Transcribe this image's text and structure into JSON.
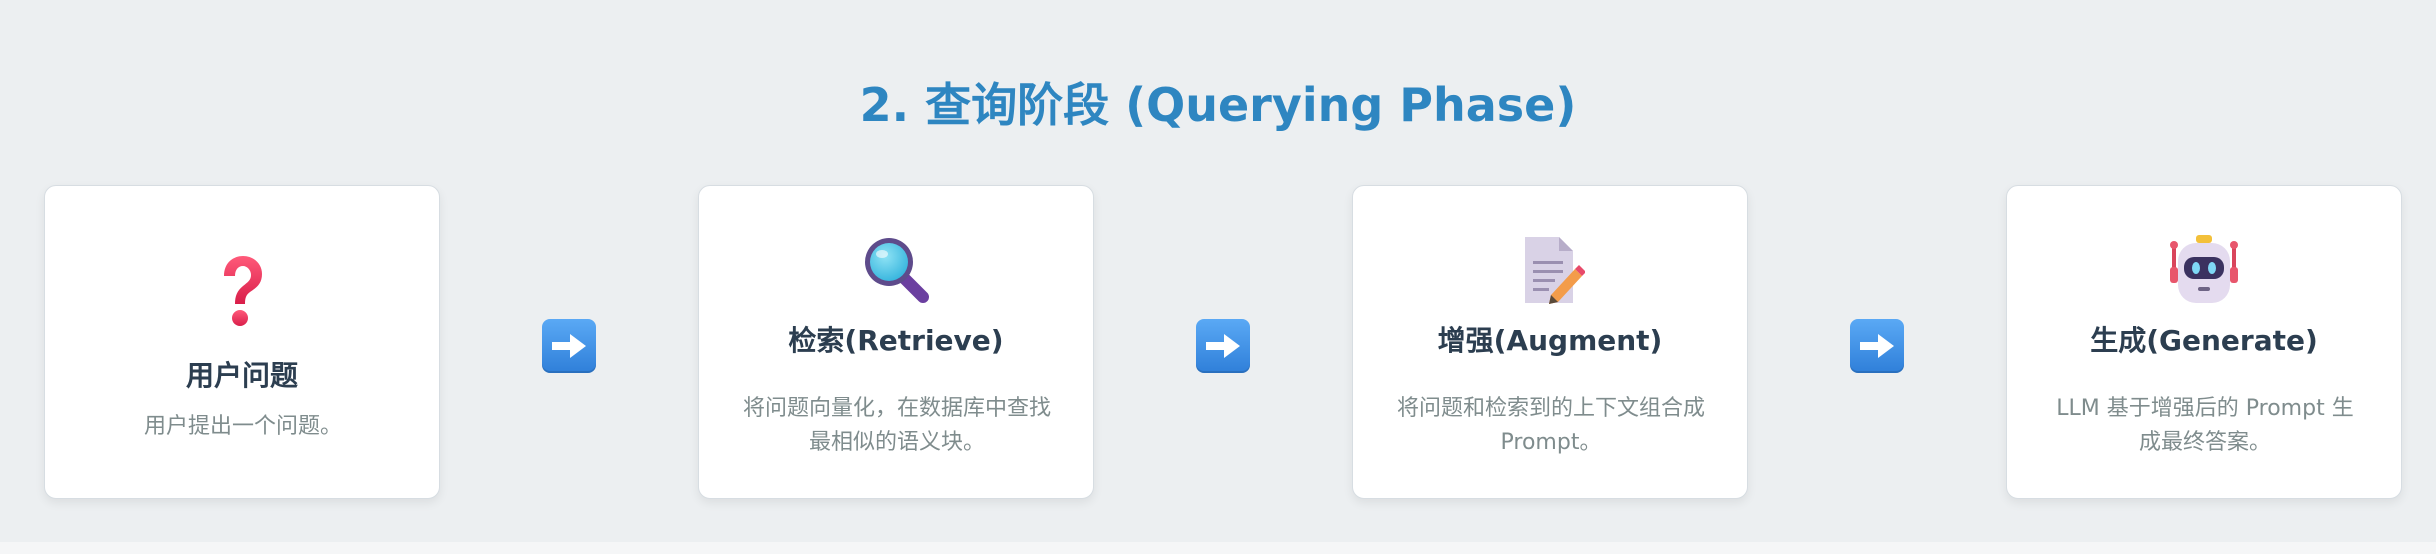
{
  "title": "2. 查询阶段 (Querying Phase)",
  "steps": [
    {
      "label": "用户问题",
      "desc": "用户提出一个问题。",
      "icon": "question-mark-icon"
    },
    {
      "label": "检索(Retrieve)",
      "desc": "将问题向量化，在数据库中查找最相似的语义块。",
      "icon": "magnifying-glass-icon"
    },
    {
      "label": "增强(Augment)",
      "desc": "将问题和检索到的上下文组合成 Prompt。",
      "icon": "memo-pencil-icon"
    },
    {
      "label": "生成(Generate)",
      "desc": "LLM 基于增强后的 Prompt 生成最终答案。",
      "icon": "robot-icon"
    }
  ],
  "arrow_icon": "right-arrow-icon",
  "colors": {
    "title": "#2e86c1",
    "card_label": "#2c3e50",
    "card_desc": "#7f8c8d",
    "arrow": "#3b8de6"
  }
}
